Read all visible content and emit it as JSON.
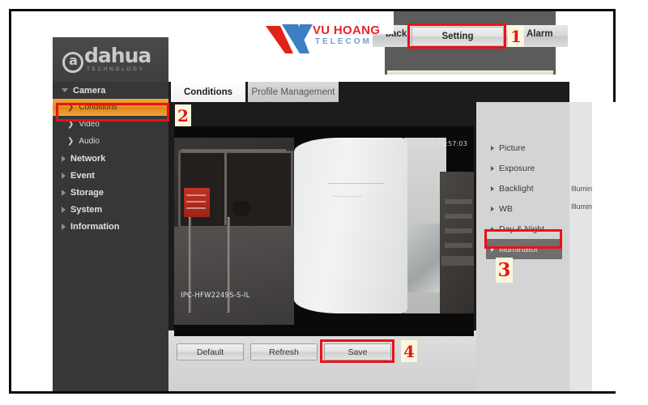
{
  "window": {
    "device_brand": "dahua",
    "device_brand_sub": "TECHNOLOGY"
  },
  "topnav": {
    "items": [
      {
        "label": "back",
        "name": "playback"
      },
      {
        "label": "Setting",
        "name": "setting"
      },
      {
        "label": "Alarm",
        "name": "alarm"
      }
    ]
  },
  "sidebar": {
    "groups": [
      {
        "label": "Camera",
        "expanded": true,
        "children": [
          {
            "label": "Conditions",
            "active": true
          },
          {
            "label": "Video",
            "active": false
          },
          {
            "label": "Audio",
            "active": false
          }
        ]
      },
      {
        "label": "Network",
        "expanded": false,
        "children": []
      },
      {
        "label": "Event",
        "expanded": false,
        "children": []
      },
      {
        "label": "Storage",
        "expanded": false,
        "children": []
      },
      {
        "label": "System",
        "expanded": false,
        "children": []
      },
      {
        "label": "Information",
        "expanded": false,
        "children": []
      }
    ]
  },
  "tabs": [
    {
      "label": "Conditions",
      "active": true
    },
    {
      "label": "Profile Management",
      "active": false
    }
  ],
  "video": {
    "timestamp": "2022-11-24 16:57:03",
    "model": "IPC-HFW2249S-S-IL"
  },
  "buttons": [
    {
      "label": "Default",
      "name": "default-button"
    },
    {
      "label": "Refresh",
      "name": "refresh-button"
    },
    {
      "label": "Save",
      "name": "save-button"
    }
  ],
  "condition_menu": [
    {
      "label": "Picture",
      "selected": false
    },
    {
      "label": "Exposure",
      "selected": false
    },
    {
      "label": "Backlight",
      "selected": false
    },
    {
      "label": "WB",
      "selected": false
    },
    {
      "label": "Day & Night",
      "selected": false
    },
    {
      "label": "Illuminator",
      "selected": true
    }
  ],
  "settings_labels": [
    {
      "label": "Illumin"
    },
    {
      "label": "Illumin"
    }
  ],
  "annotations": {
    "markers": [
      {
        "number": "1",
        "target": "Setting"
      },
      {
        "number": "2",
        "target": "Conditions"
      },
      {
        "number": "3",
        "target": "Illuminator"
      },
      {
        "number": "4",
        "target": "Save"
      }
    ],
    "highlight_color": "#e8121a",
    "marker_bg": "#fbf7df"
  },
  "watermark": {
    "title": "VU HOANG",
    "subtitle": "TELECOM",
    "title_color": "#e8242c",
    "subtitle_color": "#3d7fc1"
  }
}
